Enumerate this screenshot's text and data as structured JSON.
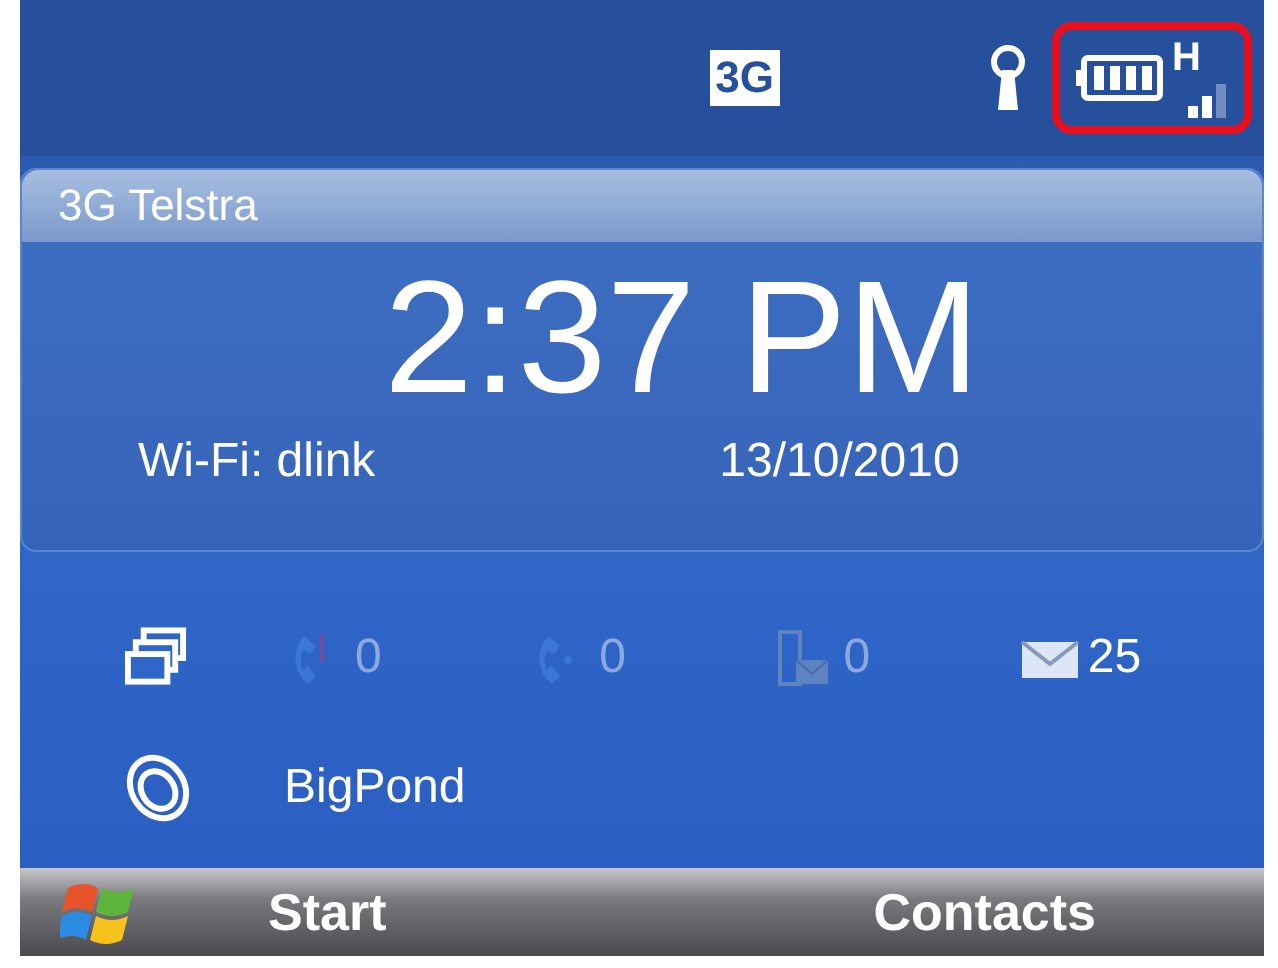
{
  "status_bar": {
    "network_badge": "3G",
    "data_mode": "H",
    "highlight": true
  },
  "today": {
    "operator": "3G Telstra",
    "time": "2:37 PM",
    "wifi": "Wi-Fi: dlink",
    "date": "13/10/2010"
  },
  "notifications": [
    {
      "kind": "missed-call",
      "count": "0",
      "dimmed": true
    },
    {
      "kind": "voicemail",
      "count": "0",
      "dimmed": true
    },
    {
      "kind": "sms",
      "count": "0",
      "dimmed": true
    },
    {
      "kind": "email",
      "count": "25",
      "dimmed": false
    }
  ],
  "apps": [
    {
      "kind": "internet",
      "label": "BigPond"
    }
  ],
  "softkeys": [
    "Start",
    "Contacts"
  ]
}
